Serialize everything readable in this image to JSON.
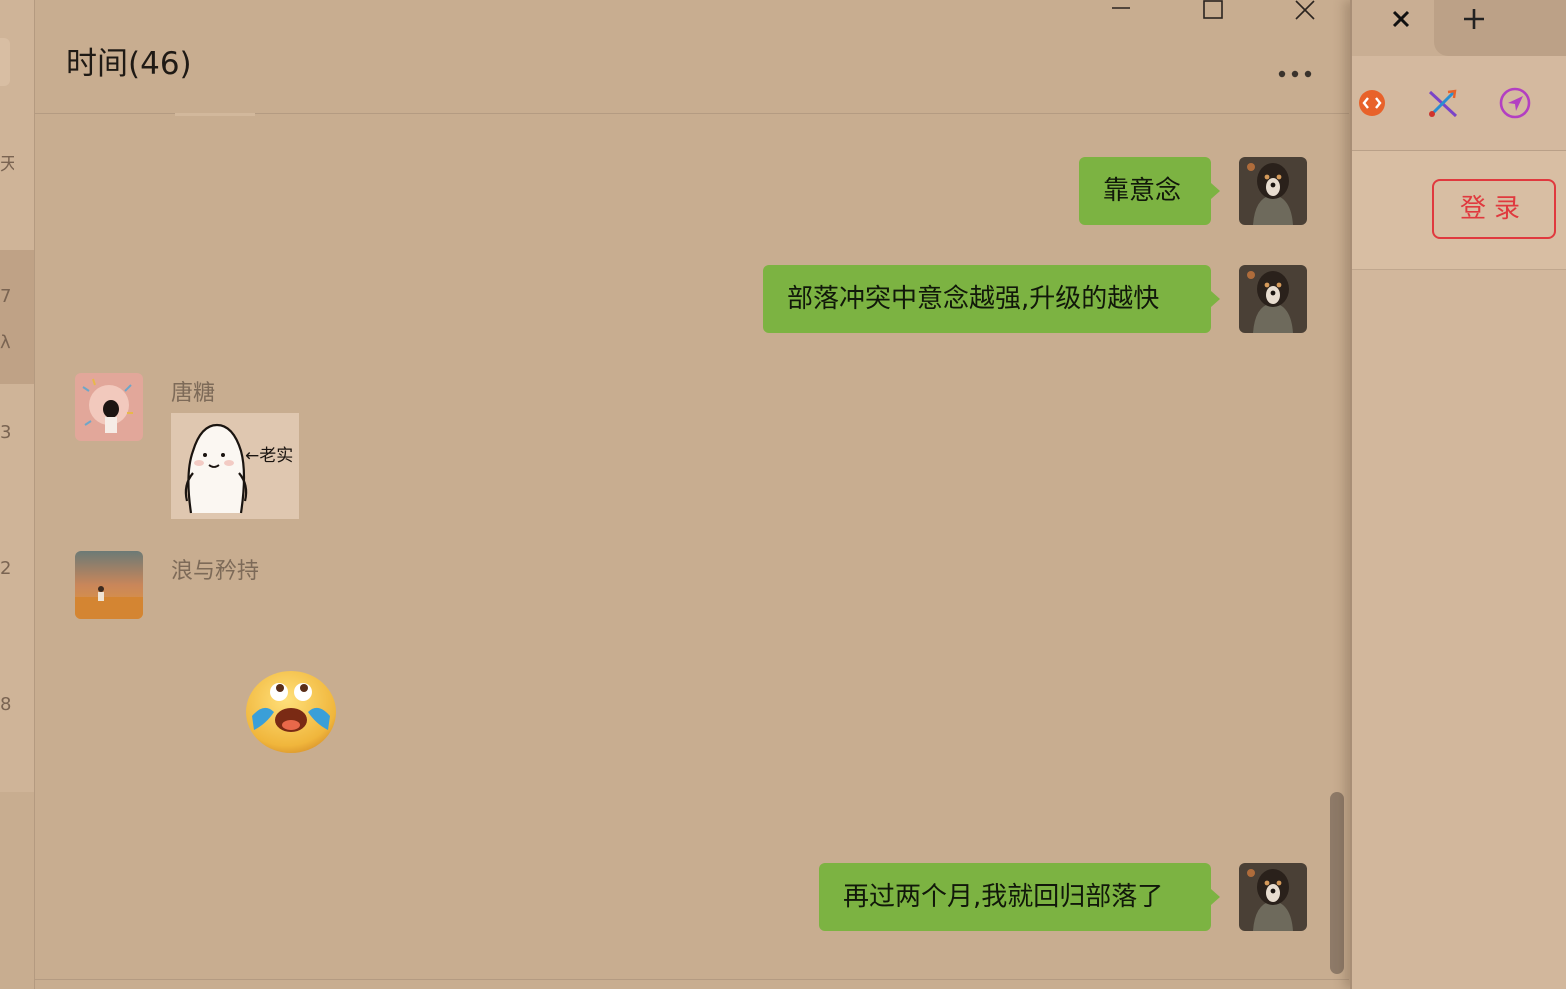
{
  "chat": {
    "title": "时间(46)",
    "messages": [
      {
        "direction": "out",
        "text": "靠意念"
      },
      {
        "direction": "out",
        "text": "部落冲突中意念越强,升级的越快"
      },
      {
        "direction": "in",
        "sender": "唐糖",
        "type": "sticker",
        "sticker_caption": "←老实"
      },
      {
        "direction": "in",
        "sender": "浪与矜持",
        "type": "emoji",
        "emoji": "laugh-cry-emoji"
      },
      {
        "direction": "out",
        "text": "再过两个月,我就回归部落了"
      }
    ]
  },
  "window_controls": [
    "minimize-icon",
    "maximize-icon",
    "close-icon"
  ],
  "left_list": {
    "fragments": [
      "天",
      "7",
      "λ",
      "3",
      "2",
      "8"
    ]
  },
  "browser": {
    "tab_close_icon": "close-icon",
    "new_tab_icon": "plus-icon",
    "extensions": [
      "orange-code-extension-icon",
      "cross-arrows-extension-icon",
      "purple-send-extension-icon"
    ],
    "login_label": "登录"
  },
  "colors": {
    "background": "#c8ad90",
    "bubble_out": "#7cb342",
    "login_accent": "#e0393e"
  }
}
